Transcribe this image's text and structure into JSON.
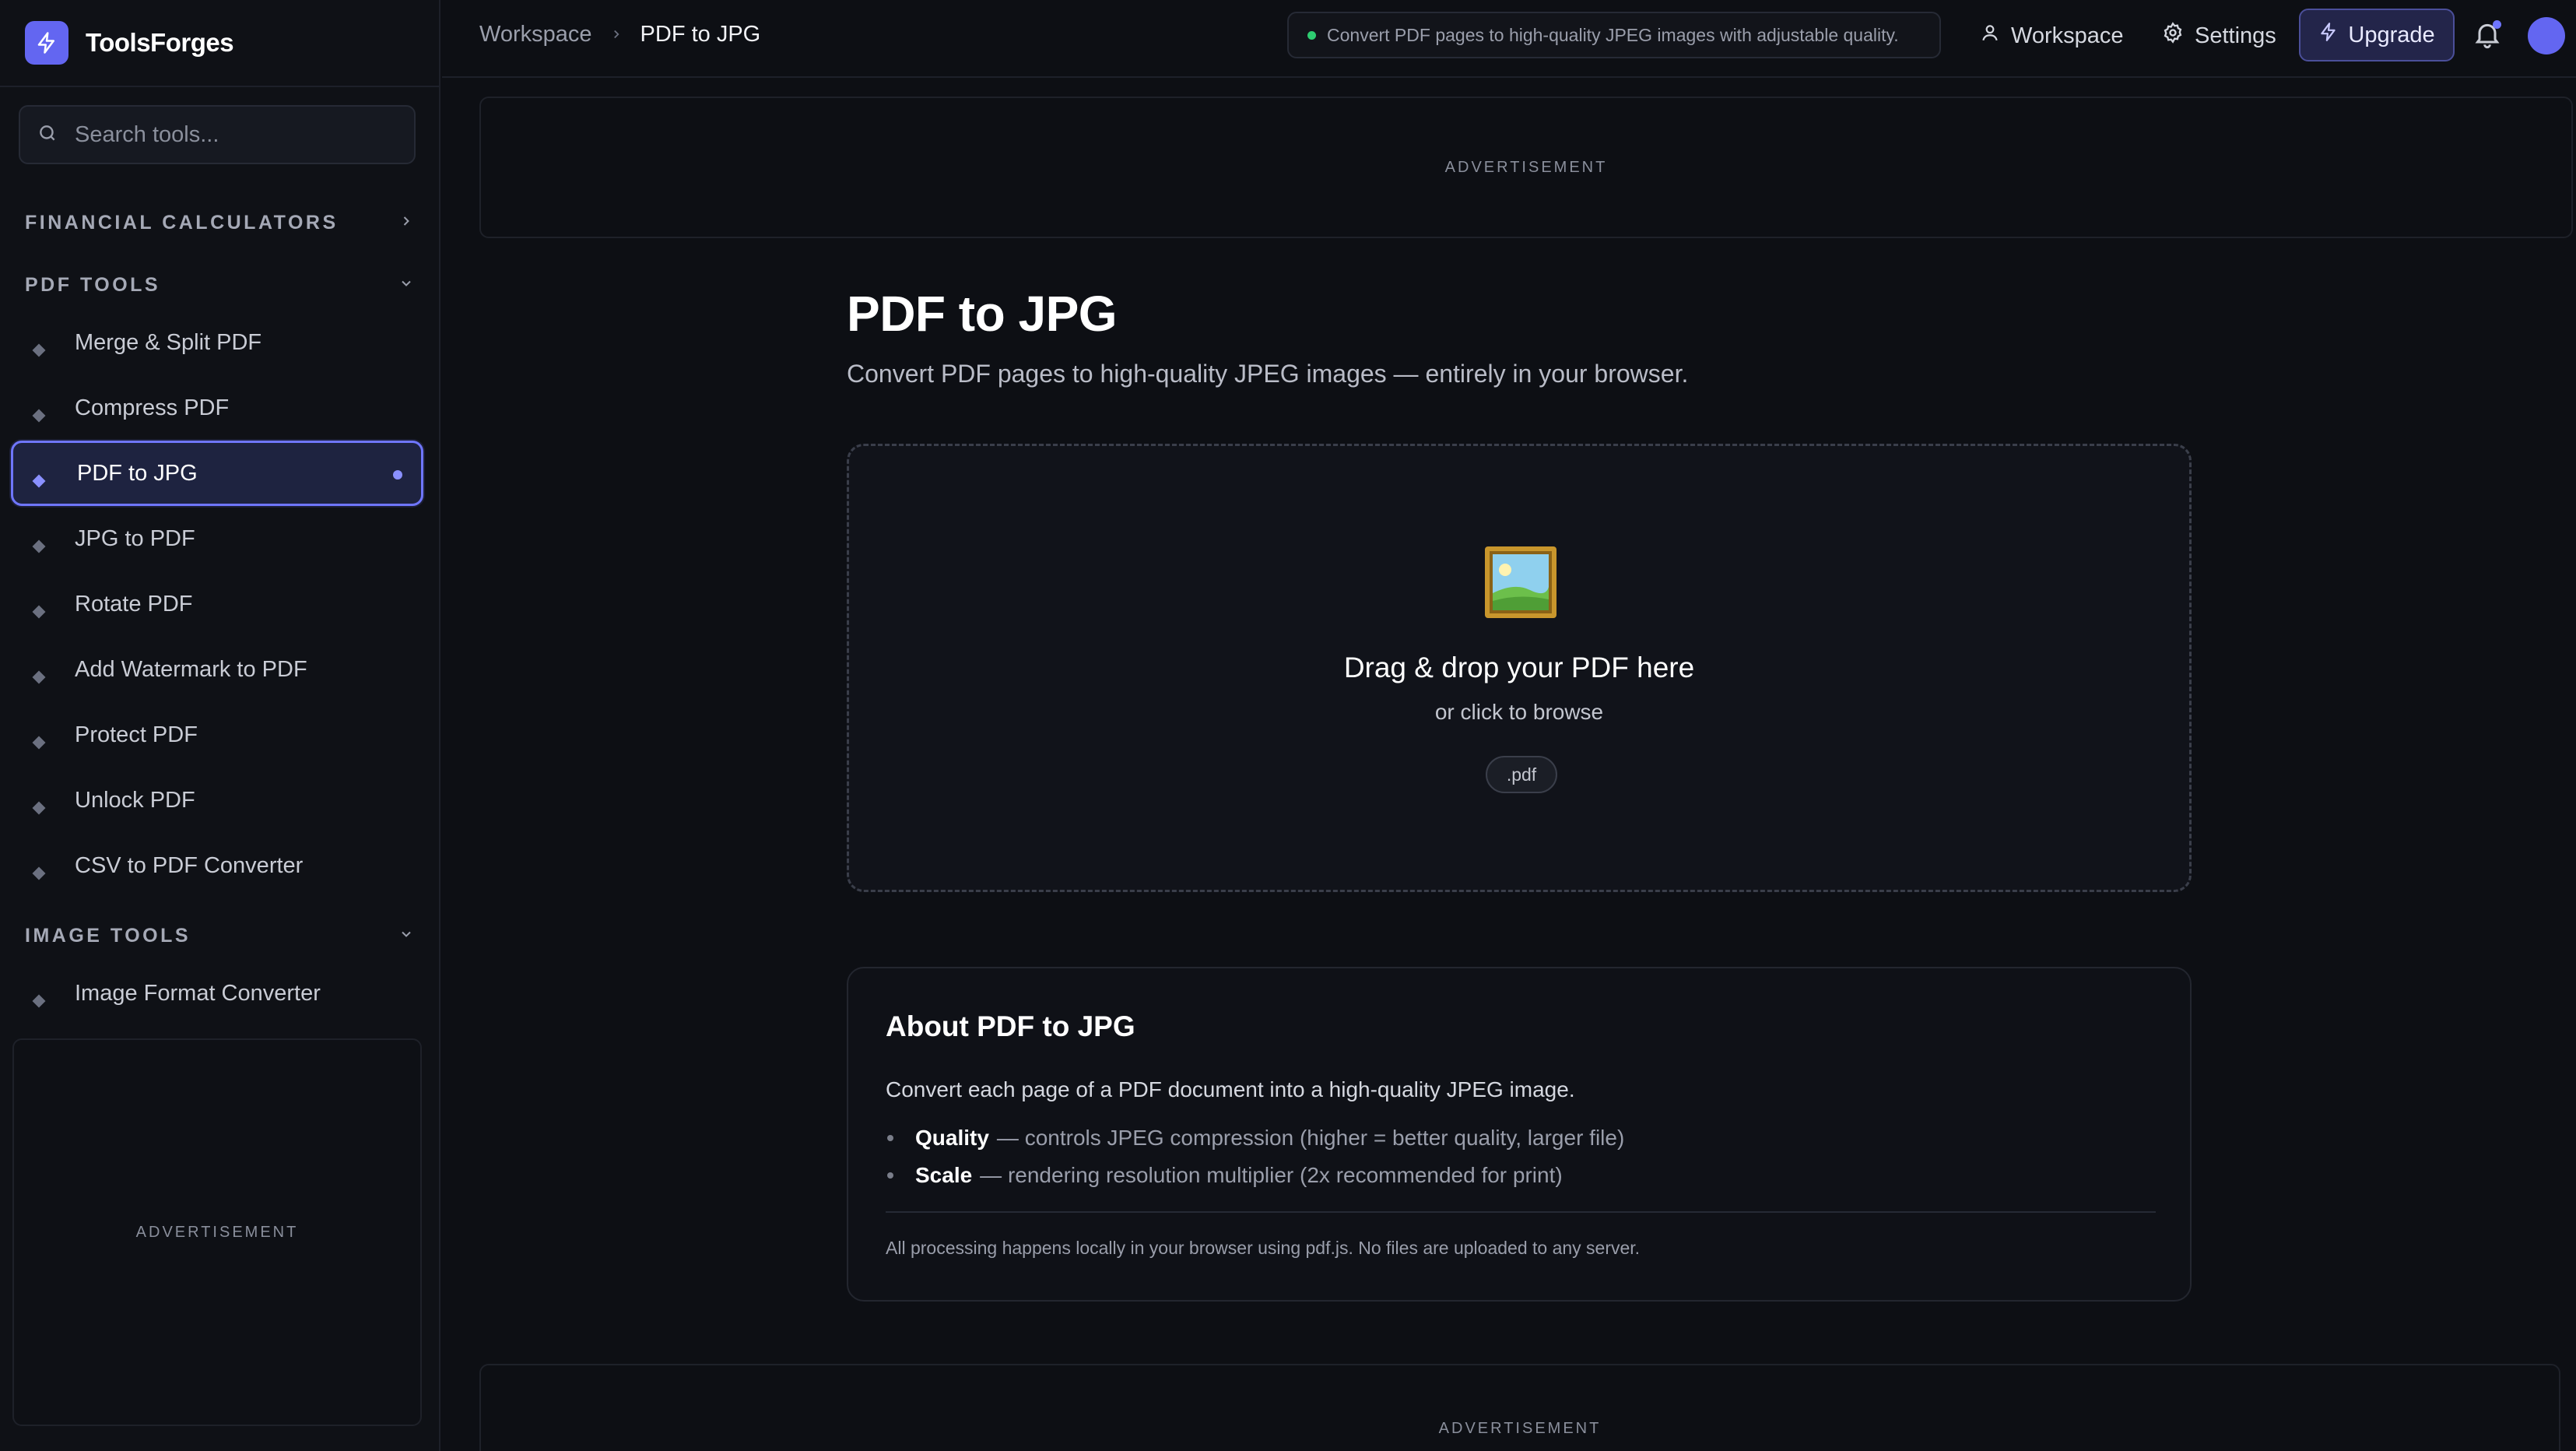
{
  "brand": {
    "name": "ToolsForges"
  },
  "search": {
    "placeholder": "Search tools..."
  },
  "sidebar": {
    "sections": [
      {
        "title": "FINANCIAL CALCULATORS",
        "expanded": false
      },
      {
        "title": "PDF TOOLS",
        "expanded": true
      },
      {
        "title": "IMAGE TOOLS",
        "expanded": true
      }
    ],
    "pdf_items": [
      "Merge & Split PDF",
      "Compress PDF",
      "PDF to JPG",
      "JPG to PDF",
      "Rotate PDF",
      "Add Watermark to PDF",
      "Protect PDF",
      "Unlock PDF",
      "CSV to PDF Converter"
    ],
    "active_item": "PDF to JPG",
    "image_items": [
      "Image Format Converter"
    ],
    "ad_label": "ADVERTISEMENT"
  },
  "topbar": {
    "breadcrumb": [
      "Workspace",
      "PDF to JPG"
    ],
    "tagline": "Convert PDF pages to high-quality JPEG images with adjustable quality.",
    "workspace_label": "Workspace",
    "settings_label": "Settings",
    "upgrade_label": "Upgrade"
  },
  "main": {
    "ad_label": "ADVERTISEMENT",
    "title": "PDF to JPG",
    "subtitle": "Convert PDF pages to high-quality JPEG images — entirely in your browser.",
    "dropzone": {
      "title": "Drag & drop your PDF here",
      "subtitle": "or click to browse",
      "badge": ".pdf"
    },
    "about": {
      "title": "About PDF to JPG",
      "description": "Convert each page of a PDF document into a high-quality JPEG image.",
      "bullets": [
        {
          "term": "Quality",
          "text": "— controls JPEG compression (higher = better quality, larger file)"
        },
        {
          "term": "Scale",
          "text": "— rendering resolution multiplier (2x recommended for print)"
        }
      ],
      "footnote": "All processing happens locally in your browser using pdf.js. No files are uploaded to any server."
    }
  },
  "colors": {
    "accent": "#6366f1",
    "background": "#0d0f14",
    "status_dot": "#2ecc71"
  }
}
